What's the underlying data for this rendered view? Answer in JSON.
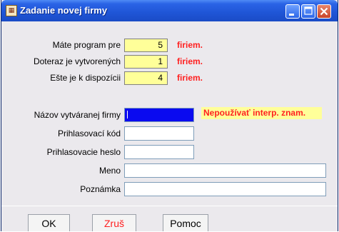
{
  "window": {
    "title": "Zadanie novej firmy"
  },
  "summary": [
    {
      "label": "Máte program pre",
      "value": "5",
      "unit": "firiem."
    },
    {
      "label": "Doteraz je vytvorených",
      "value": "1",
      "unit": "firiem."
    },
    {
      "label": "Ešte je k dispozícii",
      "value": "4",
      "unit": "firiem."
    }
  ],
  "form": {
    "company_name_label": "Názov vytváranej firmy",
    "company_name_value": "",
    "company_name_warning": "Nepoužívať interp. znam.",
    "login_code_label": "Prihlasovací kód",
    "login_code_value": "",
    "login_password_label": "Prihlasovacie heslo",
    "login_password_value": "",
    "meno_label": "Meno",
    "meno_value": "",
    "note_label": "Poznámka",
    "note_value": ""
  },
  "buttons": {
    "ok": "OK",
    "cancel": "Zruš",
    "help": "Pomoc"
  },
  "colors": {
    "titlebar": "#1f55d6",
    "highlight_yellow": "#ffff99",
    "warning_red": "#ff2020",
    "focused_field": "#0a0af0"
  }
}
